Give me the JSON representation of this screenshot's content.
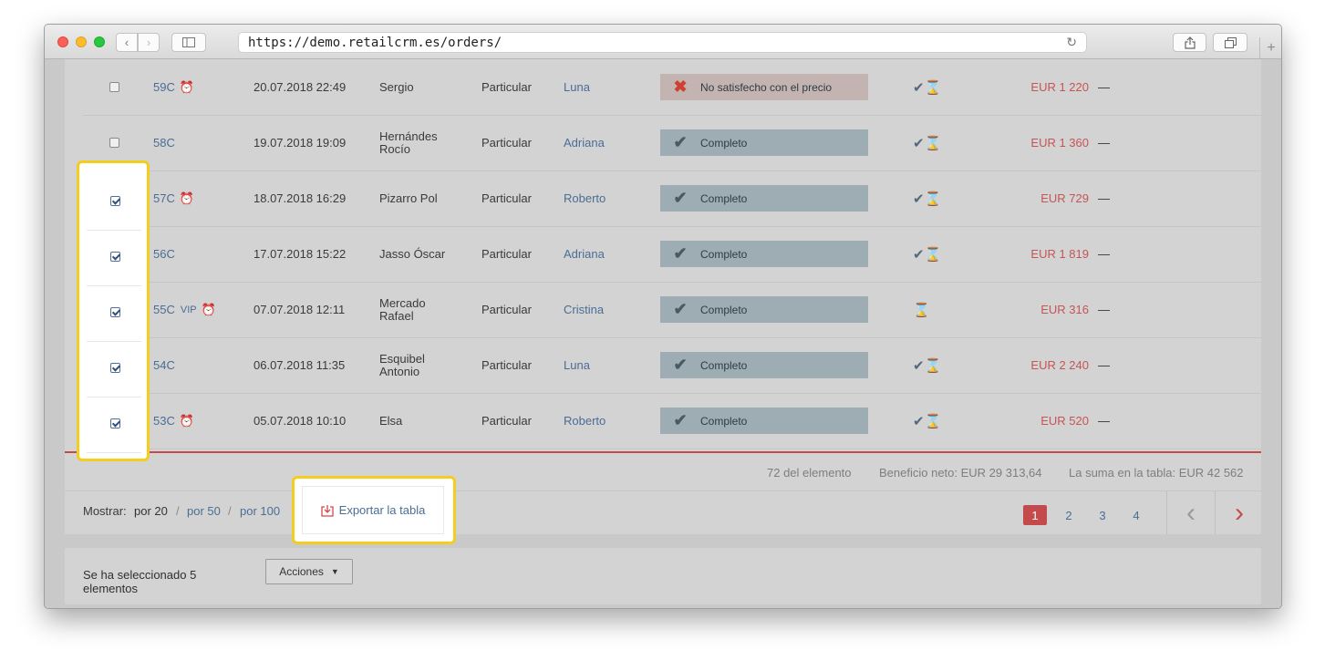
{
  "browser": {
    "url": "https://demo.retailcrm.es/orders/"
  },
  "orders": [
    {
      "checked": false,
      "number": "59C",
      "vip": "",
      "alarm": true,
      "date": "20.07.2018 22:49",
      "name": "Sergio",
      "type": "Particular",
      "manager": "Luna",
      "status": "No satisfecho con el precio",
      "status_kind": "rejected",
      "pay_icon": "delivered-paid-icon",
      "amount": "EUR 1 220",
      "extra": "—"
    },
    {
      "checked": false,
      "number": "58C",
      "vip": "",
      "alarm": false,
      "date": "19.07.2018 19:09",
      "name": "Hernándes Rocío",
      "type": "Particular",
      "manager": "Adriana",
      "status": "Completo",
      "status_kind": "complete",
      "pay_icon": "delivered-paid-icon",
      "amount": "EUR 1 360",
      "extra": "—"
    },
    {
      "checked": true,
      "number": "57C",
      "vip": "",
      "alarm": true,
      "date": "18.07.2018 16:29",
      "name": "Pizarro Pol",
      "type": "Particular",
      "manager": "Roberto",
      "status": "Completo",
      "status_kind": "complete",
      "pay_icon": "delivered-paid-icon",
      "amount": "EUR 729",
      "extra": "—"
    },
    {
      "checked": true,
      "number": "56C",
      "vip": "",
      "alarm": false,
      "date": "17.07.2018 15:22",
      "name": "Jasso Óscar",
      "type": "Particular",
      "manager": "Adriana",
      "status": "Completo",
      "status_kind": "complete",
      "pay_icon": "delivered-paid-icon",
      "amount": "EUR 1 819",
      "extra": "—"
    },
    {
      "checked": true,
      "number": "55C",
      "vip": "VIP",
      "alarm": true,
      "date": "07.07.2018 12:11",
      "name": "Mercado Rafael",
      "type": "Particular",
      "manager": "Cristina",
      "status": "Completo",
      "status_kind": "complete",
      "pay_icon": "hourglass-icon",
      "amount": "EUR 316",
      "extra": "—"
    },
    {
      "checked": true,
      "number": "54C",
      "vip": "",
      "alarm": false,
      "date": "06.07.2018 11:35",
      "name": "Esquibel Antonio",
      "type": "Particular",
      "manager": "Luna",
      "status": "Completo",
      "status_kind": "complete",
      "pay_icon": "delivered-paid-icon",
      "amount": "EUR 2 240",
      "extra": "—"
    },
    {
      "checked": true,
      "number": "53C",
      "vip": "",
      "alarm": true,
      "date": "05.07.2018 10:10",
      "name": "Elsa",
      "type": "Particular",
      "manager": "Roberto",
      "status": "Completo",
      "status_kind": "complete",
      "pay_icon": "delivered-paid-icon",
      "amount": "EUR 520",
      "extra": "—"
    }
  ],
  "totals": {
    "count": "72 del elemento",
    "net_profit": "Beneficio neto: EUR 29 313,64",
    "table_sum": "La suma en la tabla: EUR 42 562"
  },
  "footer": {
    "show_label": "Mostrar:",
    "per_page": [
      "por 20",
      "por 50",
      "por 100"
    ],
    "per_page_selected": "por 20",
    "separator": "/",
    "export_label": "Exportar la tabla",
    "pages": [
      "1",
      "2",
      "3",
      "4"
    ],
    "current_page": "1"
  },
  "selection": {
    "text": "Se ha seleccionado 5 elementos",
    "actions_label": "Acciones"
  },
  "colors": {
    "accent_red": "#c44b4b",
    "link_blue": "#4a6d95",
    "highlight_yellow": "#f5cd1c"
  }
}
